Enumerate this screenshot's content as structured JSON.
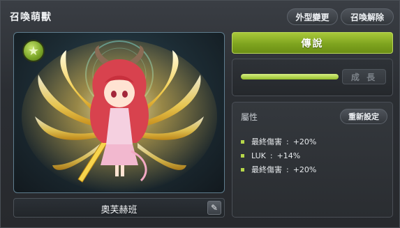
{
  "window": {
    "title": "召喚萌獸"
  },
  "toolbar": {
    "appearance_label": "外型變更",
    "release_label": "召喚解除"
  },
  "pet": {
    "name": "奧芙赫班",
    "grade_icon": "star-icon"
  },
  "legend_button": {
    "label": "傳說"
  },
  "growth": {
    "progress_percent": 100,
    "button_label": "成 長"
  },
  "attributes": {
    "title": "屬性",
    "reset_label": "重新設定",
    "items": [
      {
        "name": "最終傷害",
        "sep": ":",
        "value": "+20%"
      },
      {
        "name": "LUK",
        "sep": ":",
        "value": "+14%"
      },
      {
        "name": "最終傷害",
        "sep": ":",
        "value": "+20%"
      }
    ]
  },
  "colors": {
    "accent_green": "#8fb52a",
    "bullet": "#b6d64a"
  }
}
